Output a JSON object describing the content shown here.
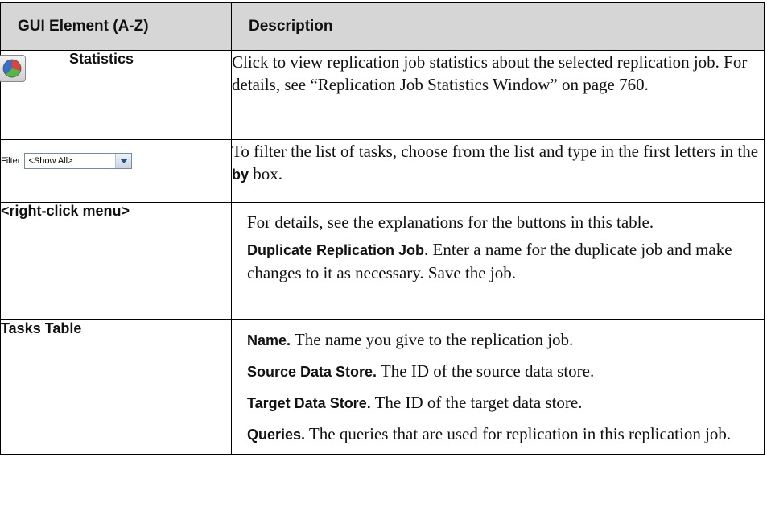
{
  "header": {
    "col1": "GUI Element (A-Z)",
    "col2": "Description"
  },
  "rows": {
    "statistics": {
      "label": "Statistics",
      "icon": "pie-chart-icon",
      "description": "Click to view replication job statistics about the selected replication job. For details, see “Replication Job Statistics Window” on page 760."
    },
    "filter": {
      "widget_label": "Filter",
      "widget_value": "<Show All>",
      "description_pre": "To filter the list of tasks, choose from the list and type in the first letters in the ",
      "description_bold": "by",
      "description_post": " box."
    },
    "right_click": {
      "label": "<right-click menu>",
      "para1": "For details, see the explanations for the buttons in this table.",
      "para2_bold": "Duplicate Replication Job",
      "para2_text": ". Enter a name for the duplicate job and make changes to it as necessary. Save the job."
    },
    "tasks_table": {
      "label": "Tasks Table",
      "items": [
        {
          "term": "Name.",
          "text": " The name you give to the replication job."
        },
        {
          "term": "Source Data Store.",
          "text": " The ID of the source data store."
        },
        {
          "term": "Target Data Store.",
          "text": " The ID of the target data store."
        },
        {
          "term": "Queries.",
          "text": " The queries that are used for replication in this replication job."
        }
      ]
    }
  },
  "colors": {
    "header_bg": "#d6d6d6",
    "border": "#000000",
    "text": "#111111"
  }
}
